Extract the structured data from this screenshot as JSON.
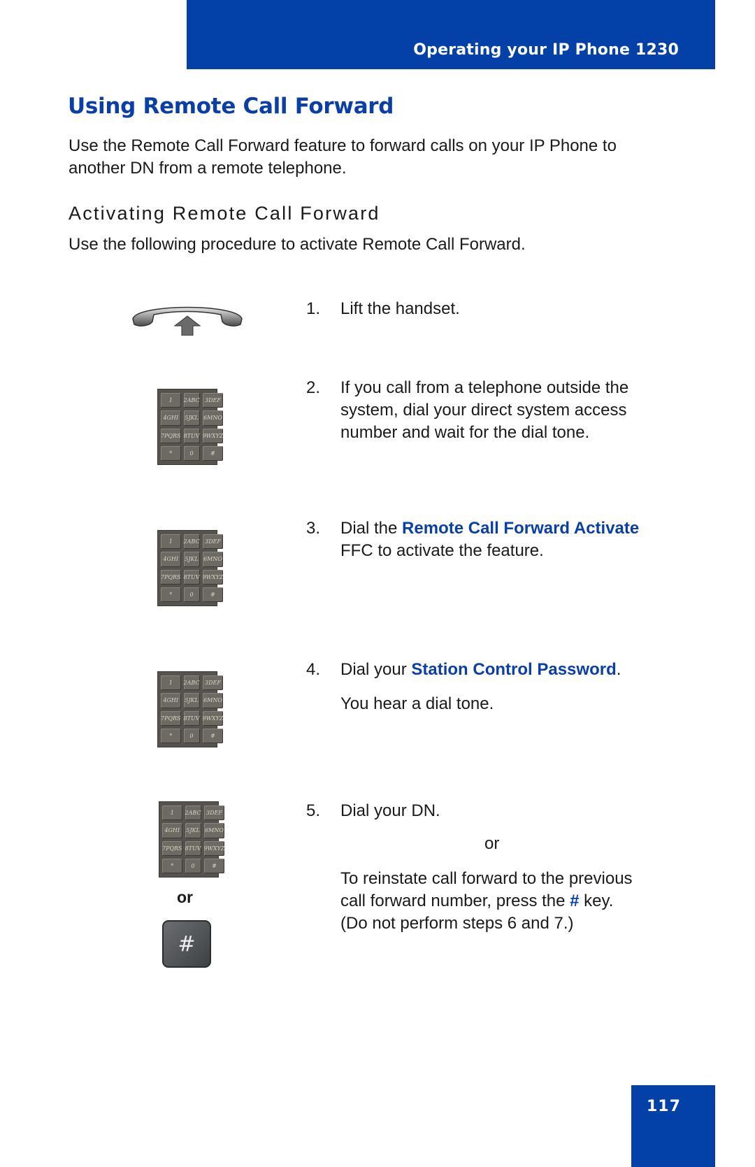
{
  "header": {
    "title": "Operating your IP Phone 1230"
  },
  "page": {
    "title": "Using Remote Call Forward",
    "intro_lines": [
      "Use the Remote Call Forward feature to forward calls on your IP Phone to",
      "another DN from a remote telephone."
    ],
    "subheading": "Activating Remote Call Forward",
    "procedure_intro": "Use the following procedure to activate Remote Call Forward."
  },
  "steps": [
    {
      "number": "1.",
      "lines": [
        "Lift the handset."
      ],
      "icon": "handset-lift-icon"
    },
    {
      "number": "2.",
      "lines": [
        "If you call from a telephone outside the",
        "system, dial your direct system access",
        "number and wait for the dial tone."
      ],
      "icon": "dialpad-icon"
    },
    {
      "number": "3.",
      "prefix": "Dial the ",
      "highlight": "Remote Call Forward Activate",
      "line2": "FFC to activate the feature.",
      "icon": "dialpad-icon"
    },
    {
      "number": "4.",
      "prefix": "Dial your ",
      "highlight": "Station Control Password",
      "suffix": ".",
      "note": "You hear a dial tone.",
      "icon": "dialpad-icon"
    },
    {
      "number": "5.",
      "line1": "Dial your DN.",
      "or": "or",
      "alt_line1": "To reinstate call forward to the previous",
      "alt_prefix": "call forward number, press the ",
      "alt_highlight": "#",
      "alt_suffix": " key.",
      "alt_line3": "(Do not perform steps 6 and 7.)",
      "icons": [
        "dialpad-icon",
        "hash-key-icon"
      ],
      "icon_separator": "or"
    }
  ],
  "keypad": {
    "keys": [
      "1",
      "2ABC",
      "3DEF",
      "4GHI",
      "5JKL",
      "6MNO",
      "7PQRS",
      "8TUV",
      "9WXYZ",
      "*",
      "0",
      "#"
    ]
  },
  "hash_key": {
    "label": "#"
  },
  "footer": {
    "page_number": "117"
  },
  "colors": {
    "brand_blue": "#0341a9",
    "link_blue": "#0a3fa8"
  }
}
